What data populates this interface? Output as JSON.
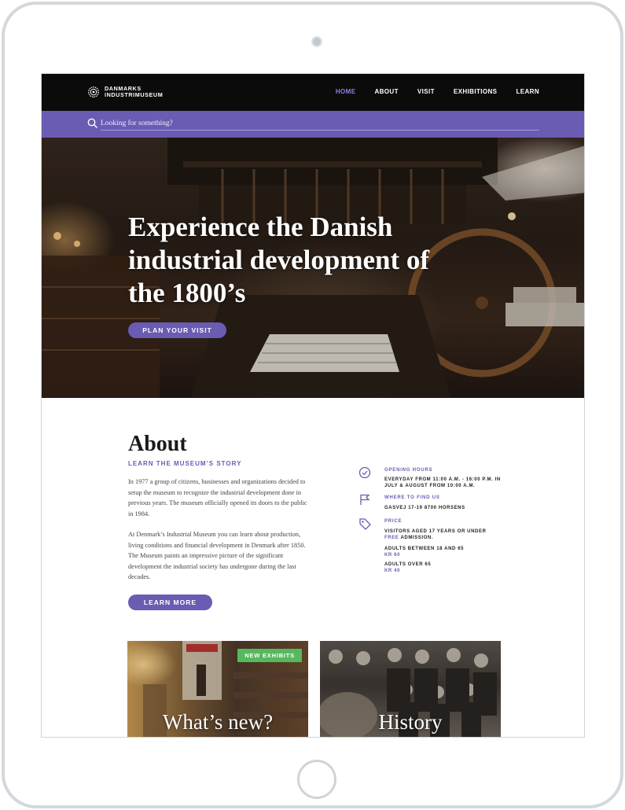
{
  "brand": {
    "line1": "DANMARKS",
    "line2": "INDUSTRIMUSEUM"
  },
  "nav": {
    "items": [
      {
        "label": "HOME",
        "active": true
      },
      {
        "label": "ABOUT",
        "active": false
      },
      {
        "label": "VISIT",
        "active": false
      },
      {
        "label": "EXHIBITIONS",
        "active": false
      },
      {
        "label": "LEARN",
        "active": false
      }
    ]
  },
  "search": {
    "placeholder": "Looking for something?",
    "icon": "search-icon"
  },
  "hero": {
    "title": "Experience the Danish industrial development of the 1800’s",
    "button": "PLAN YOUR VISIT"
  },
  "about": {
    "heading": "About",
    "subheading": "LEARN THE MUSEUM’S STORY",
    "paragraph1": "In 1977 a group of citizens, businesses and organizations decided to setup the museum to recognize the industrial development done in previous years. The museum officially opened its doors to the public in 1984.",
    "paragraph2": "At Denmark’s Industrial Museum you can learn about production, living conditions and financial development in Denmark after 1850. The Museum paints an impressive picture of the significant development the industrial society has undergone during the last decades.",
    "button": "LEARN MORE"
  },
  "info": {
    "hours": {
      "icon": "clock-icon",
      "label": "OPENING HOURS",
      "text": "EVERYDAY FROM 11:00 A.M. - 16:00 P.M. IN JULY & AUGUST FROM 10:00 A.M."
    },
    "location": {
      "icon": "flag-icon",
      "label": "WHERE TO FIND US",
      "text": "GASVEJ 17-19 8700 HORSENS"
    },
    "price": {
      "icon": "price-tag-icon",
      "label": "PRICE",
      "youth_text_pre": "VISITORS AGED 17 YEARS OR UNDER",
      "youth_free": "FREE",
      "youth_text_post": "ADMISSION.",
      "adult_label": "ADULTS BETWEEN 18 AND 65",
      "adult_price": "KR 60",
      "senior_label": "ADULTS OVER 65",
      "senior_price": "KR 40"
    }
  },
  "cards": {
    "new": {
      "title": "What’s new?",
      "badge": "NEW EXHIBITS"
    },
    "history": {
      "title": "History"
    }
  },
  "colors": {
    "accent": "#6a5bb3",
    "nav_bg": "#0b0b0c",
    "badge": "#56b95e"
  }
}
